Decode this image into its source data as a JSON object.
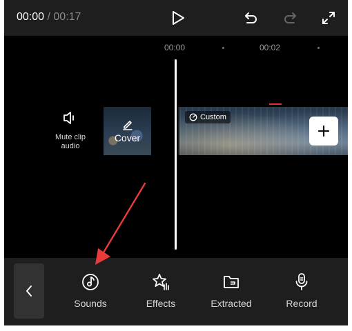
{
  "header": {
    "current_time": "00:00",
    "separator": " / ",
    "total_time": "00:17"
  },
  "ruler": {
    "labels": [
      "00:00",
      "00:02"
    ]
  },
  "left_actions": {
    "mute_label": "Mute clip audio",
    "cover_label": "Cover"
  },
  "clip": {
    "tag_label": "Custom"
  },
  "toolbar": {
    "items": [
      {
        "label": "Sounds",
        "icon": "music-note-icon"
      },
      {
        "label": "Effects",
        "icon": "sparkle-star-icon"
      },
      {
        "label": "Extracted",
        "icon": "folder-icon"
      },
      {
        "label": "Record",
        "icon": "microphone-icon"
      }
    ]
  },
  "colors": {
    "annotation_arrow": "#e83b3b",
    "playhead": "#ffffff",
    "bar_background": "#1e1e1e"
  }
}
